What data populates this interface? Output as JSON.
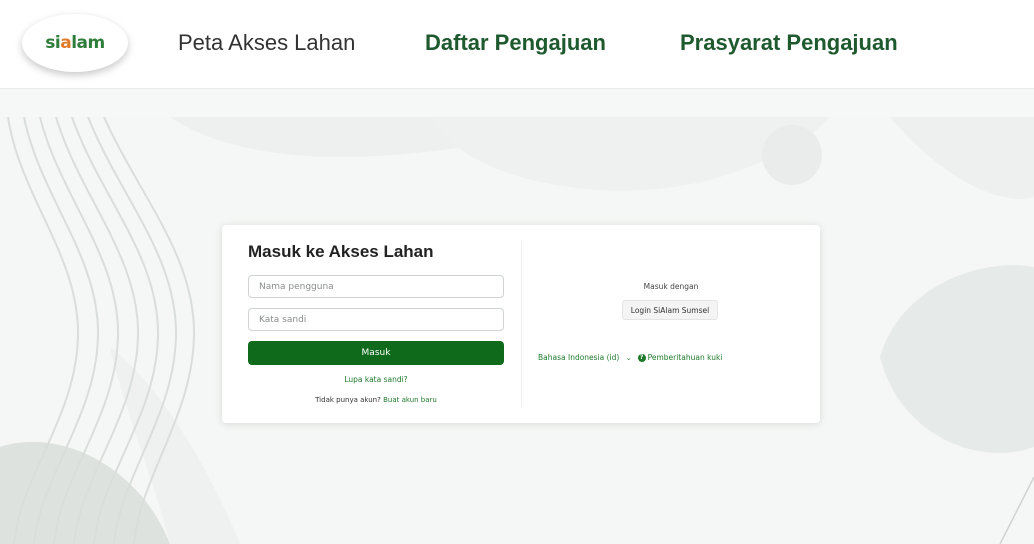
{
  "header": {
    "logo_text_pre": "si",
    "logo_text_o": "a",
    "logo_text_post": "lam",
    "nav": [
      {
        "label": "Peta Akses Lahan"
      },
      {
        "label": "Daftar Pengajuan"
      },
      {
        "label": "Prasyarat Pengajuan"
      }
    ]
  },
  "login": {
    "title": "Masuk ke Akses Lahan",
    "username_placeholder": "Nama pengguna",
    "password_placeholder": "Kata sandi",
    "submit_label": "Masuk",
    "forgot_label": "Lupa kata sandi?",
    "no_account_text": "Tidak punya akun?",
    "signup_label": "Buat akun baru"
  },
  "oauth": {
    "label": "Masuk dengan",
    "button_label": "Login SiAlam Sumsel"
  },
  "footer": {
    "language_label": "Bahasa Indonesia (id)",
    "cookie_label": "Pemberitahuan kuki"
  },
  "colors": {
    "brand_green": "#0f6b1b",
    "nav_green": "#1f5a2f",
    "link_green": "#1f7a2b",
    "logo_orange": "#e07b2a"
  },
  "icons": {
    "chevron": "chevron-down-icon",
    "help": "question-circle-icon"
  }
}
